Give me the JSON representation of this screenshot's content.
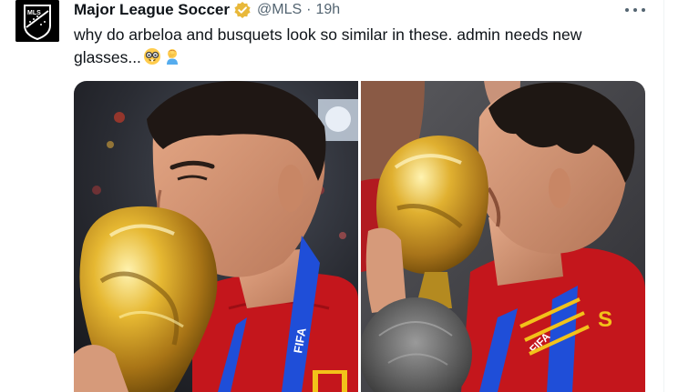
{
  "tweet": {
    "author_name": "Major League Soccer",
    "handle": "@MLS",
    "separator": "·",
    "time": "19h",
    "text": "why do arbeloa and busquets look so similar in these. admin needs new glasses...",
    "emojis": [
      "nerd-face",
      "man-facepalming"
    ],
    "avatar_text": "MLS"
  },
  "media": {
    "photo_left": {
      "label_text": "FIFA"
    },
    "photo_right": {
      "label_text": "FIFA",
      "shirt_letter": "S"
    }
  },
  "colors": {
    "verified_badge": "#e8b83a",
    "secondary_text": "#536471",
    "primary_text": "#0f1419",
    "shirt_red": "#c4161c",
    "lanyard_blue": "#1f4ed8",
    "trophy_gold": "#d4a017"
  }
}
